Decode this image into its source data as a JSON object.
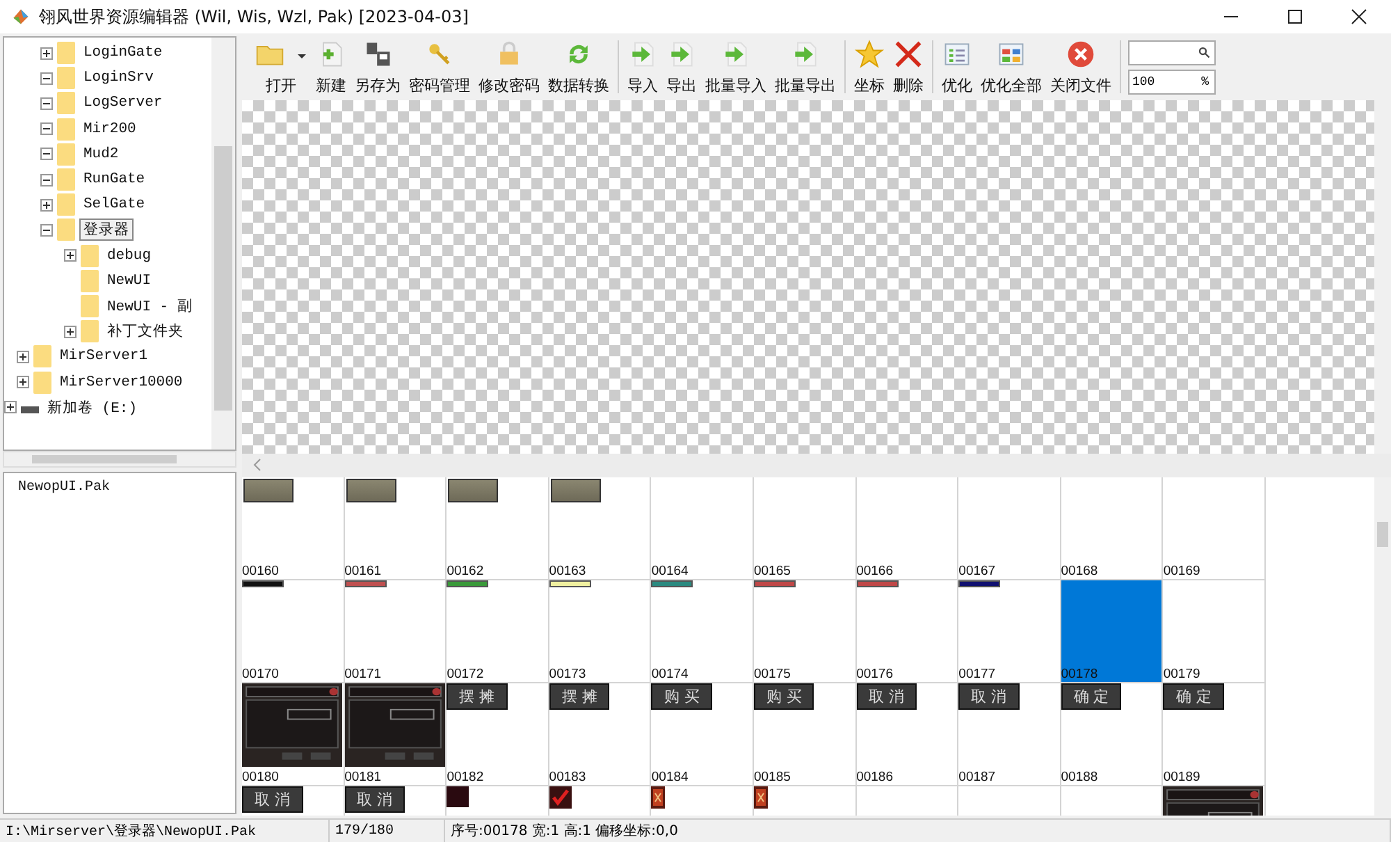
{
  "window": {
    "title": "翎风世界资源编辑器 (Wil, Wis, Wzl, Pak) [2023-04-03]"
  },
  "tree": [
    {
      "children": [
        {
          "children": [
            {
              "label": "LoginGate",
              "expanded": false,
              "selected": false
            },
            {
              "label": "LoginSrv",
              "expanded": true,
              "selected": false
            },
            {
              "label": "LogServer",
              "expanded": true,
              "selected": false
            },
            {
              "label": "Mir200",
              "expanded": true,
              "selected": false
            },
            {
              "label": "Mud2",
              "expanded": true,
              "selected": false
            },
            {
              "label": "RunGate",
              "expanded": true,
              "selected": false
            },
            {
              "label": "SelGate",
              "expanded": false,
              "selected": false
            },
            {
              "label": "登录器",
              "expanded": true,
              "selected": true,
              "children": [
                {
                  "label": "debug",
                  "expanded": false,
                  "selected": false
                },
                {
                  "label": "NewUI",
                  "selected": false
                },
                {
                  "label": "NewUI - 副",
                  "selected": false
                },
                {
                  "label": "补丁文件夹",
                  "expanded": false,
                  "selected": false
                }
              ]
            }
          ]
        },
        {
          "label": "MirServer1",
          "expanded": false,
          "selected": false
        },
        {
          "label": "MirServer10000",
          "expanded": false,
          "selected": false
        }
      ]
    },
    {
      "label": "新加卷 (E:)",
      "expanded": false,
      "kind": "drive",
      "selected": false
    }
  ],
  "files": [
    "NewopUI.Pak"
  ],
  "toolbar": [
    {
      "label": "打开",
      "kind": "folder",
      "dropdown": true
    },
    {
      "label": "新建",
      "kind": "new"
    },
    {
      "label": "另存为",
      "kind": "save"
    },
    {
      "label": "密码管理",
      "kind": "key"
    },
    {
      "label": "修改密码",
      "kind": "lock"
    },
    {
      "label": "数据转换",
      "kind": "convert",
      "separator_after": true
    },
    {
      "label": "导入",
      "kind": "arrow"
    },
    {
      "label": "导出",
      "kind": "arrow"
    },
    {
      "label": "批量导入",
      "kind": "arrow"
    },
    {
      "label": "批量导出",
      "kind": "arrow",
      "separator_after": true
    },
    {
      "label": "坐标",
      "kind": "star"
    },
    {
      "label": "删除",
      "kind": "delete",
      "separator_after": true
    },
    {
      "label": "优化",
      "kind": "list"
    },
    {
      "label": "优化全部",
      "kind": "grid"
    },
    {
      "label": "关闭文件",
      "kind": "close"
    }
  ],
  "zoom": {
    "value": "100",
    "unit": "%"
  },
  "cells": [
    {
      "kind": "stone",
      "label": "00160",
      "selected": false
    },
    {
      "kind": "stone",
      "label": "00161",
      "selected": false
    },
    {
      "kind": "stone",
      "label": "00162",
      "selected": false
    },
    {
      "kind": "stone",
      "label": "00163",
      "selected": false
    },
    {
      "kind": "blank",
      "label": "00164",
      "selected": false
    },
    {
      "kind": "blank",
      "label": "00165",
      "selected": false
    },
    {
      "kind": "blank",
      "label": "00166",
      "selected": false
    },
    {
      "kind": "blank",
      "label": "00167",
      "selected": false
    },
    {
      "kind": "blank",
      "label": "00168",
      "selected": false
    },
    {
      "kind": "blank",
      "label": "00169",
      "selected": false
    },
    {
      "kind": "bar",
      "color": "#111111",
      "label": "00170",
      "selected": false
    },
    {
      "kind": "bar",
      "color": "#c05050",
      "label": "00171",
      "selected": false
    },
    {
      "kind": "bar",
      "color": "#3a9a3a",
      "label": "00172",
      "selected": false
    },
    {
      "kind": "bar",
      "color": "#f0f0a0",
      "label": "00173",
      "selected": false
    },
    {
      "kind": "bar",
      "color": "#2a8a80",
      "label": "00174",
      "selected": false
    },
    {
      "kind": "bar",
      "color": "#c04848",
      "label": "00175",
      "selected": false
    },
    {
      "kind": "bar",
      "color": "#c04848",
      "label": "00176",
      "selected": false
    },
    {
      "kind": "bar",
      "color": "#101070",
      "label": "00177",
      "selected": false
    },
    {
      "kind": "blank",
      "label": "00178",
      "selected": true
    },
    {
      "kind": "blank",
      "label": "00179",
      "selected": false
    },
    {
      "kind": "dialog",
      "label": "00180",
      "selected": false
    },
    {
      "kind": "dialog",
      "label": "00181",
      "selected": false
    },
    {
      "kind": "button",
      "caption": "摆 摊",
      "label": "00182",
      "selected": false
    },
    {
      "kind": "button",
      "caption": "摆 摊",
      "label": "00183",
      "selected": false
    },
    {
      "kind": "button",
      "caption": "购 买",
      "label": "00184",
      "selected": false
    },
    {
      "kind": "button",
      "caption": "购 买",
      "label": "00185",
      "selected": false
    },
    {
      "kind": "button",
      "caption": "取 消",
      "label": "00186",
      "selected": false
    },
    {
      "kind": "button",
      "caption": "取 消",
      "label": "00187",
      "selected": false
    },
    {
      "kind": "button",
      "caption": "确 定",
      "label": "00188",
      "selected": false
    },
    {
      "kind": "button",
      "caption": "确 定",
      "label": "00189",
      "selected": false
    },
    {
      "kind": "button",
      "caption": "取 消",
      "selected": false
    },
    {
      "kind": "button",
      "caption": "取 消",
      "selected": false
    },
    {
      "kind": "dark",
      "selected": false
    },
    {
      "kind": "check",
      "selected": false
    },
    {
      "kind": "cross",
      "selected": false
    },
    {
      "kind": "cross",
      "selected": false
    },
    {
      "kind": "blank",
      "selected": false
    },
    {
      "kind": "blank",
      "selected": false
    },
    {
      "kind": "blank",
      "selected": false
    },
    {
      "kind": "dialog",
      "selected": false
    }
  ],
  "status_bar": {
    "path": "I:\\Mirserver\\登录器\\NewopUI.Pak",
    "count": "179/180",
    "info": "序号:00178 宽:1 高:1 偏移坐标:0,0"
  }
}
